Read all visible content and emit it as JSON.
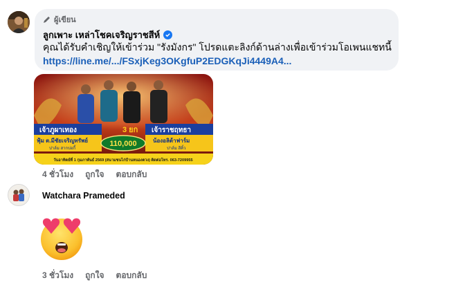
{
  "comment1": {
    "badge": "ผู้เขียน",
    "author": "ลูกเพาะ เหล่าโชคเจริญราชสีห์",
    "text": "คุณได้รับคำเชิญให้เข้าร่วม \"รังมังกร\" โปรดแตะลิงก์ด้านล่างเพื่อเข้าร่วมโอเพนแชทนี้",
    "link": "https://line.me/.../FSxjKeg3OKgfuP2EDGKqJi4449A4...",
    "time": "4 ชั่วโมง",
    "like": "ถูกใจ",
    "reply": "ตอบกลับ"
  },
  "poster": {
    "left_title": "เจ้าภูผาเทอง",
    "rounds": "3 ยก",
    "right_title": "เจ้าราชฤทธา",
    "left_owner": "ฟุ้ม ต.มีชัยเจริญทรัพย์",
    "left_sub": "ปาล์ม สากบ่อกี้",
    "right_owner": "น้องอลิต้าฟาร์ม",
    "right_sub": "ปาล์ม สีคิ้ว",
    "prize": "110,000",
    "footer": "วันอาทิตย์ที่ 1 กุมภาพันธ์ 2569 (สนามชนไก่บ้านหนองตวง) ติดต่อโทร. 063-7209955"
  },
  "comment2": {
    "author": "Watchara Prameded",
    "time": "3 ชั่วโมง",
    "like": "ถูกใจ",
    "reply": "ตอบกลับ"
  },
  "colors": {
    "bubble_bg": "#f0f2f5",
    "link": "#1a5fb8",
    "meta": "#65676b",
    "verified": "#1877f2"
  },
  "icons": [
    "pen-icon",
    "verified-badge-icon",
    "heart-eyes-emoji"
  ]
}
